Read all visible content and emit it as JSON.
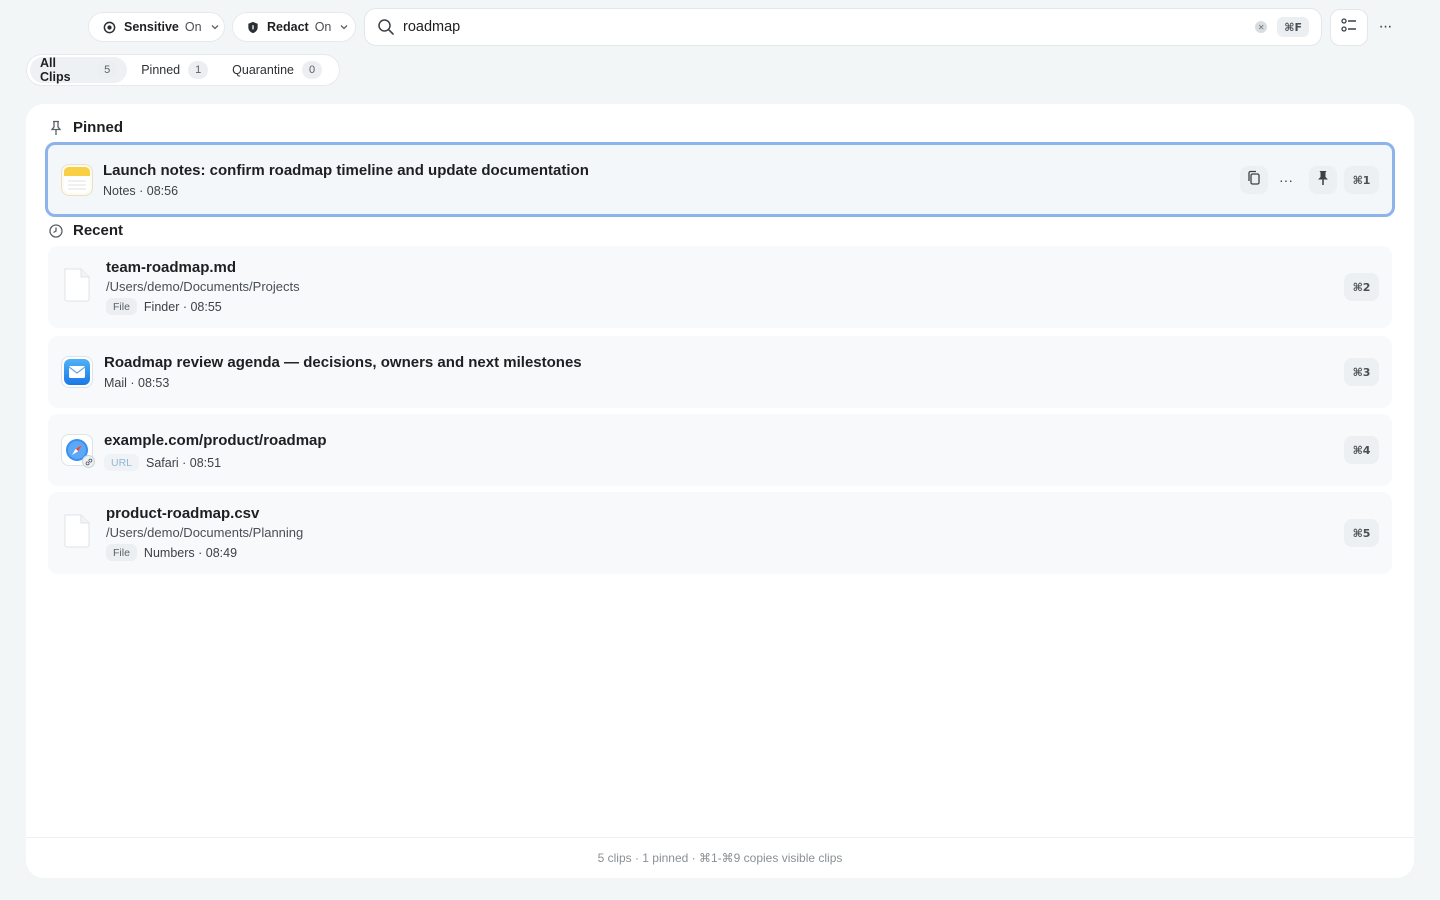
{
  "toolbar": {
    "sensitive": {
      "label": "Sensitive",
      "value": "On",
      "icon": "eye-shield-icon"
    },
    "redact": {
      "label": "Redact",
      "value": "On",
      "icon": "shield-icon"
    },
    "search": {
      "value": "roadmap",
      "shortcut": "⌘F",
      "icon": "search-icon"
    },
    "list_button_icon": "checklist-icon",
    "more_icon": "more-icon"
  },
  "tabs": [
    {
      "label": "All Clips",
      "count": "5",
      "active": true
    },
    {
      "label": "Pinned",
      "count": "1",
      "active": false
    },
    {
      "label": "Quarantine",
      "count": "0",
      "active": false
    }
  ],
  "sections": {
    "pinned": {
      "label": "Pinned",
      "icon": "pin-icon"
    },
    "recent": {
      "label": "Recent",
      "icon": "clock-icon"
    }
  },
  "pinned_clips": [
    {
      "title": "Launch notes: confirm roadmap timeline and update documentation",
      "meta": "Notes · 08:56",
      "app_icon": "notes-app-icon",
      "shortcut": "⌘1",
      "actions": [
        "copy-icon",
        "more-icon",
        "pin-icon"
      ]
    }
  ],
  "recent_clips": [
    {
      "title": "team-roadmap.md",
      "path": "/Users/demo/Documents/Projects",
      "badge": "File",
      "meta": "Finder · 08:55",
      "app_icon": "document-icon",
      "shortcut": "⌘2"
    },
    {
      "title": "Roadmap review agenda — decisions, owners and next milestones",
      "meta": "Mail · 08:53",
      "app_icon": "mail-app-icon",
      "shortcut": "⌘3"
    },
    {
      "title": "example.com/product/roadmap",
      "badge": "URL",
      "meta": "Safari · 08:51",
      "app_icon": "safari-app-icon",
      "shortcut": "⌘4"
    },
    {
      "title": "product-roadmap.csv",
      "path": "/Users/demo/Documents/Planning",
      "badge": "File",
      "meta": "Numbers · 08:49",
      "app_icon": "document-icon",
      "shortcut": "⌘5"
    }
  ],
  "footer": {
    "text": "5 clips · 1 pinned · ⌘1-⌘9 copies visible clips"
  },
  "colors": {
    "selection_border": "#8cb4ea",
    "background": "#f3f6f7",
    "panel": "#ffffff"
  }
}
